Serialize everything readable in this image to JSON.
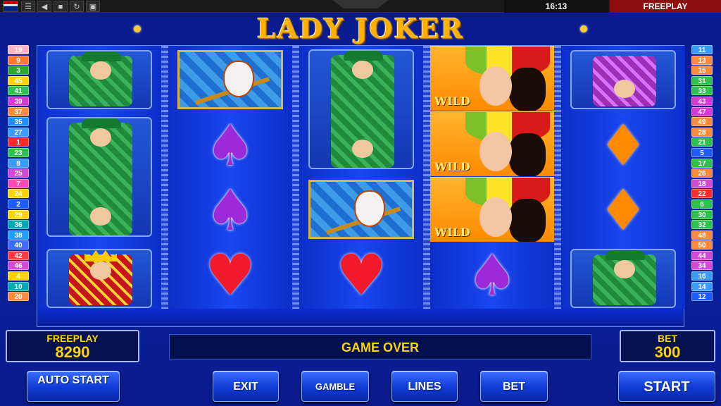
{
  "topbar": {
    "time": "16:13",
    "mode": "FREEPLAY",
    "icons": [
      "uk-flag-icon",
      "menu-icon",
      "sound-icon",
      "fullscreen-icon",
      "reload-icon",
      "restore-icon"
    ]
  },
  "game": {
    "title": "LADY JOKER"
  },
  "lines_left": [
    "19",
    "9",
    "3",
    "45",
    "41",
    "39",
    "37",
    "35",
    "27",
    "1",
    "23",
    "8",
    "25",
    "7",
    "24",
    "2",
    "29",
    "36",
    "38",
    "40",
    "42",
    "46",
    "4",
    "10",
    "20"
  ],
  "lines_right": [
    "11",
    "13",
    "15",
    "31",
    "33",
    "43",
    "47",
    "49",
    "28",
    "21",
    "5",
    "17",
    "26",
    "18",
    "22",
    "6",
    "30",
    "32",
    "48",
    "50",
    "44",
    "34",
    "16",
    "14",
    "12"
  ],
  "reels": [
    [
      "jack-card",
      "jack-card",
      "king-card"
    ],
    [
      "joker-mask",
      "spade",
      "spade",
      "heart"
    ],
    [
      "jack-card",
      "joker-mask",
      "heart"
    ],
    [
      "wild-lady",
      "wild-lady",
      "wild-lady",
      "spade"
    ],
    [
      "queen-card",
      "diamond",
      "diamond",
      "jack-card"
    ]
  ],
  "wild_label": "WILD",
  "symbols": {
    "spade": "♠",
    "heart": "♥",
    "diamond": "♦"
  },
  "panels": {
    "credit_label": "FREEPLAY",
    "credit_value": "8290",
    "message": "GAME OVER",
    "bet_label": "BET",
    "bet_value": "300"
  },
  "buttons": {
    "auto_start": "AUTO START",
    "exit": "EXIT",
    "gamble": "GAMBLE",
    "lines": "LINES",
    "bet": "BET",
    "start": "START"
  },
  "colors": {
    "line_badges": [
      "#ffb3c2",
      "#ff7a2e",
      "#2ea82e",
      "#ffd200",
      "#2ec24a",
      "#d43ad4",
      "#ff8a3a",
      "#1f8cff",
      "#3a9cff",
      "#ff2a2a",
      "#2ec24a",
      "#3a9cff",
      "#d44ad4",
      "#ff4ab4",
      "#ffd200",
      "#1f5cff",
      "#ffd200",
      "#00a8b4",
      "#1fa0ff",
      "#3a6cff",
      "#ff3a3a",
      "#d44ad4",
      "#ffd200",
      "#00a8b4",
      "#ff8a3a"
    ],
    "line_badges_right": [
      "#3a9cff",
      "#ff8a3a",
      "#ff8a3a",
      "#2ec24a",
      "#2ec24a",
      "#d43ad4",
      "#d43ad4",
      "#ff8a3a",
      "#ff8a3a",
      "#2ec24a",
      "#1f5cff",
      "#2ec24a",
      "#ff8a3a",
      "#d44ad4",
      "#ff2a2a",
      "#2ec24a",
      "#2ec24a",
      "#2ec24a",
      "#ff8a3a",
      "#ff8a3a",
      "#d44ad4",
      "#d44ad4",
      "#3a9cff",
      "#3a9cff",
      "#1f5cff"
    ],
    "accent": "#ffd400",
    "background": "#0626a8"
  }
}
